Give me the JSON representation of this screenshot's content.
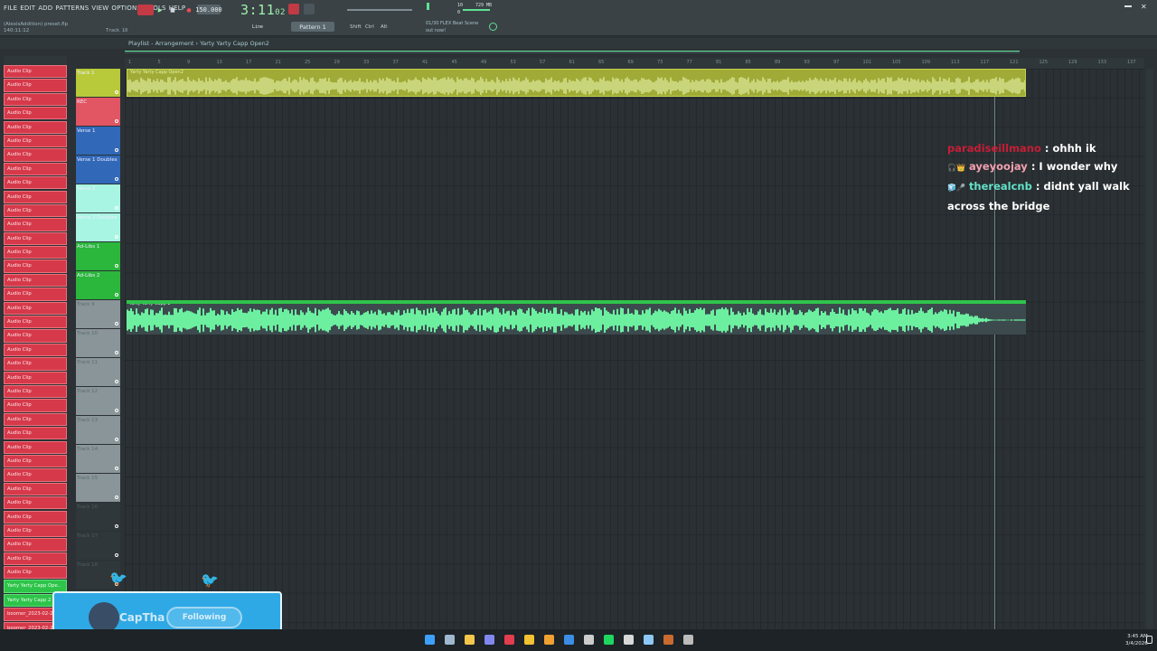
{
  "menu": [
    "FILE",
    "EDIT",
    "ADD",
    "PATTERNS",
    "VIEW",
    "OPTIONS",
    "TOOLS",
    "HELP"
  ],
  "file_info": {
    "name": "(AlexisAddition) preset.flp",
    "time": "140:11:12"
  },
  "transport": {
    "tempo": "150.000",
    "clock": "3:11",
    "clock_small": "02",
    "pattern": "Pattern 1",
    "snap": "Line",
    "track_label": "Track 10"
  },
  "toolbar_labels": {
    "shift": "Shift",
    "ctrl": "Ctrl",
    "alt": "Alt",
    "news_1": "01/30 FLEX Beat Scene",
    "news_2": "out now!",
    "mem": "729 MB",
    "cpu_a": "10",
    "cpu_b": "0"
  },
  "playlist": {
    "breadcrumb": "Playlist - Arrangement",
    "song": "Yarty Yarty Capp Open2"
  },
  "ruler_ticks": [
    "1",
    "5",
    "9",
    "13",
    "17",
    "21",
    "25",
    "29",
    "33",
    "37",
    "41",
    "45",
    "49",
    "53",
    "57",
    "61",
    "65",
    "69",
    "73",
    "77",
    "81",
    "85",
    "89",
    "93",
    "97",
    "101",
    "105",
    "109",
    "113",
    "117",
    "121",
    "125",
    "129",
    "133",
    "137"
  ],
  "clips": [
    "Audio Clip",
    "Audio Clip",
    "Audio Clip",
    "Audio Clip",
    "Audio Clip",
    "Audio Clip",
    "Audio Clip",
    "Audio Clip",
    "Audio Clip",
    "Audio Clip",
    "Audio Clip",
    "Audio Clip",
    "Audio Clip",
    "Audio Clip",
    "Audio Clip",
    "Audio Clip",
    "Audio Clip",
    "Audio Clip",
    "Audio Clip",
    "Audio Clip",
    "Audio Clip",
    "Audio Clip",
    "Audio Clip",
    "Audio Clip",
    "Audio Clip",
    "Audio Clip",
    "Audio Clip",
    "Audio Clip",
    "Audio Clip",
    "Audio Clip",
    "Audio Clip",
    "Audio Clip",
    "Audio Clip",
    "Audio Clip",
    "Audio Clip",
    "Audio Clip",
    "Audio Clip"
  ],
  "green_clips": [
    "Yarty Yarty Capp Ope..",
    "Yarty Yarty Capp 2"
  ],
  "bottom_clips": [
    "boomer_2023-02-2..",
    "boomer_2023-02-2.."
  ],
  "tracks": [
    {
      "label": "Track 1",
      "color": "#b8c93a"
    },
    {
      "label": "REC",
      "color": "#e25563"
    },
    {
      "label": "Verse 1",
      "color": "#3168b8"
    },
    {
      "label": "Verse 1 Doubles",
      "color": "#3168b8"
    },
    {
      "label": "Verse 2",
      "color": "#a8f5e3"
    },
    {
      "label": "Verse 2 Doubles",
      "color": "#a8f5e3"
    },
    {
      "label": "Ad-Libs 1",
      "color": "#2bb63c"
    },
    {
      "label": "Ad-Libs 2",
      "color": "#2bb63c"
    },
    {
      "label": "Track 9",
      "color": "#8a9599"
    },
    {
      "label": "Track 10",
      "color": "#8a9599"
    },
    {
      "label": "Track 11",
      "color": "#8a9599"
    },
    {
      "label": "Track 12",
      "color": "#8a9599"
    },
    {
      "label": "Track 13",
      "color": "#8a9599"
    },
    {
      "label": "Track 14",
      "color": "#8a9599"
    },
    {
      "label": "Track 15",
      "color": "#8a9599"
    },
    {
      "label": "Track 16",
      "color": "#2f373a"
    },
    {
      "label": "Track 17",
      "color": "#2f373a"
    },
    {
      "label": "Track 18",
      "color": "#2f373a"
    }
  ],
  "clip_blocks": [
    {
      "label": "Yarty Yarty Capp Open2",
      "color": "#9fab36"
    },
    {
      "label": "Yarty Yarty Capp 2",
      "color": "#5ee296"
    }
  ],
  "chat": [
    {
      "user": "paradiseillmano",
      "text": ": ohhh ik"
    },
    {
      "user": "ayeyoojay",
      "text": ": I wonder why"
    },
    {
      "user": "therealcnb",
      "text": ": didnt yall walk across the bridge"
    }
  ],
  "twitter": {
    "handle": "CapTha",
    "button": "Following"
  },
  "system_tray": {
    "time": "3:45 AM",
    "date": "3/4/2026"
  }
}
